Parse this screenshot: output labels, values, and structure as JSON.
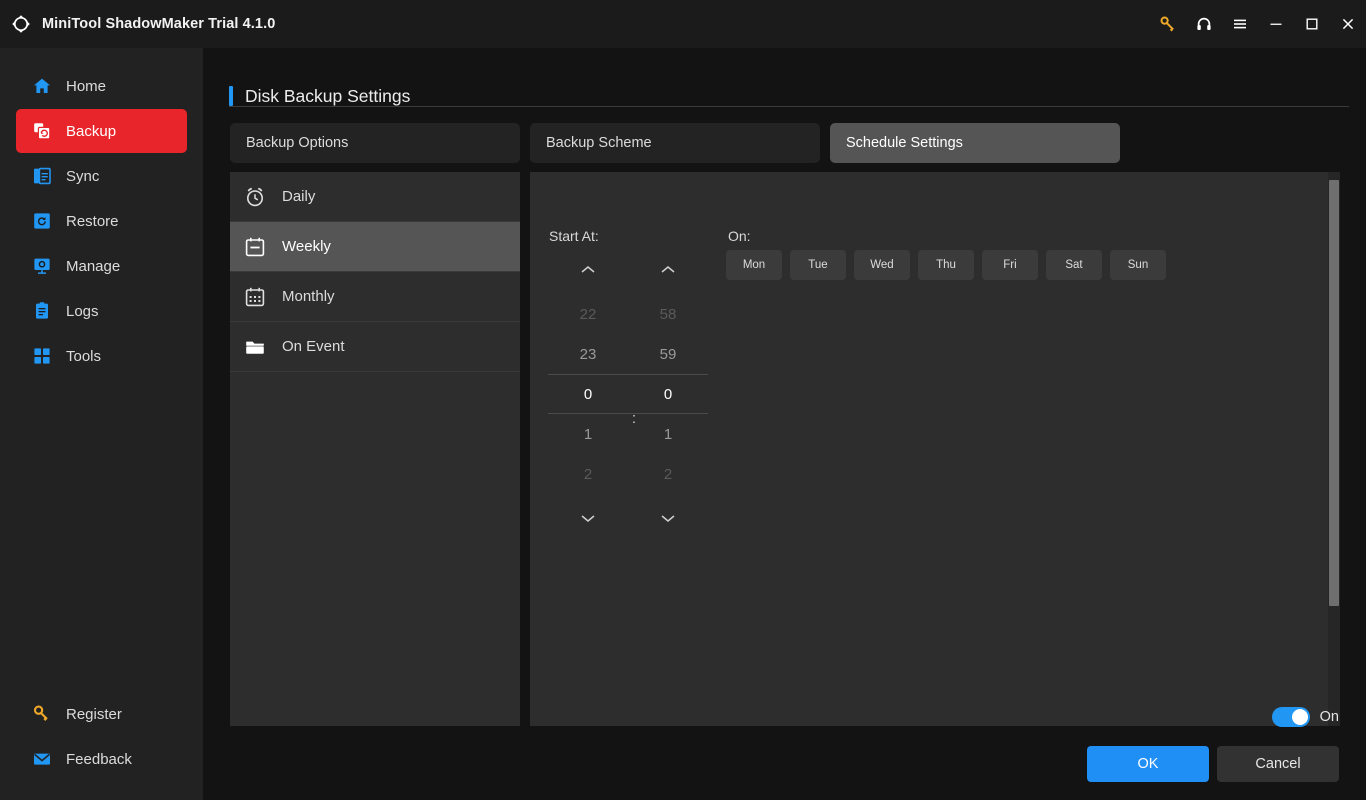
{
  "titlebar": {
    "app_title": "MiniTool ShadowMaker Trial 4.1.0",
    "logo_icon": "shadowmaker-logo-icon",
    "buttons": [
      {
        "name": "key-icon",
        "label": "",
        "color": "#f0a829"
      },
      {
        "name": "headset-icon",
        "label": "",
        "color": "#ffffff"
      },
      {
        "name": "hamburger-menu-icon",
        "label": "",
        "color": "#ffffff"
      },
      {
        "name": "minimize-icon",
        "label": "",
        "color": "#ffffff"
      },
      {
        "name": "maximize-icon",
        "label": "",
        "color": "#ffffff"
      },
      {
        "name": "close-icon",
        "label": "",
        "color": "#ffffff"
      }
    ]
  },
  "sidebar": {
    "items": [
      {
        "label": "Home",
        "icon": "home-icon",
        "active": false
      },
      {
        "label": "Backup",
        "icon": "backup-icon",
        "active": true
      },
      {
        "label": "Sync",
        "icon": "sync-icon",
        "active": false
      },
      {
        "label": "Restore",
        "icon": "restore-icon",
        "active": false
      },
      {
        "label": "Manage",
        "icon": "manage-icon",
        "active": false
      },
      {
        "label": "Logs",
        "icon": "logs-icon",
        "active": false
      },
      {
        "label": "Tools",
        "icon": "tools-icon",
        "active": false
      }
    ],
    "bottom_items": [
      {
        "label": "Register",
        "icon": "key-icon"
      },
      {
        "label": "Feedback",
        "icon": "envelope-icon"
      }
    ],
    "active_color": "#e8252a",
    "icon_color": "#2196f3"
  },
  "main": {
    "page_title": "Disk Backup Settings",
    "accent_color": "#2196f3",
    "tabs": [
      {
        "label": "Backup Options",
        "active": false
      },
      {
        "label": "Backup Scheme",
        "active": false
      },
      {
        "label": "Schedule Settings",
        "active": true
      }
    ],
    "schedule_types": [
      {
        "label": "Daily",
        "icon": "alarm-clock-icon",
        "active": false
      },
      {
        "label": "Weekly",
        "icon": "calendar-icon",
        "active": true
      },
      {
        "label": "Monthly",
        "icon": "calendar-month-icon",
        "active": false
      },
      {
        "label": "On Event",
        "icon": "folder-icon",
        "active": false
      }
    ],
    "start_at": {
      "label": "Start At:",
      "separator": ":",
      "hours": {
        "far_prev": "22",
        "near_prev": "23",
        "selected": "0",
        "near_next": "1",
        "far_next": "2"
      },
      "minutes": {
        "far_prev": "58",
        "near_prev": "59",
        "selected": "0",
        "near_next": "1",
        "far_next": "2"
      }
    },
    "on": {
      "label": "On:",
      "days": [
        {
          "label": "Mon",
          "selected": false
        },
        {
          "label": "Tue",
          "selected": false
        },
        {
          "label": "Wed",
          "selected": false
        },
        {
          "label": "Thu",
          "selected": false
        },
        {
          "label": "Fri",
          "selected": false
        },
        {
          "label": "Sat",
          "selected": false
        },
        {
          "label": "Sun",
          "selected": false
        }
      ]
    },
    "toggle": {
      "state_label": "On",
      "enabled": true,
      "color": "#2196f3"
    },
    "footer": {
      "ok_label": "OK",
      "cancel_label": "Cancel",
      "ok_color": "#1f8ff5"
    }
  }
}
